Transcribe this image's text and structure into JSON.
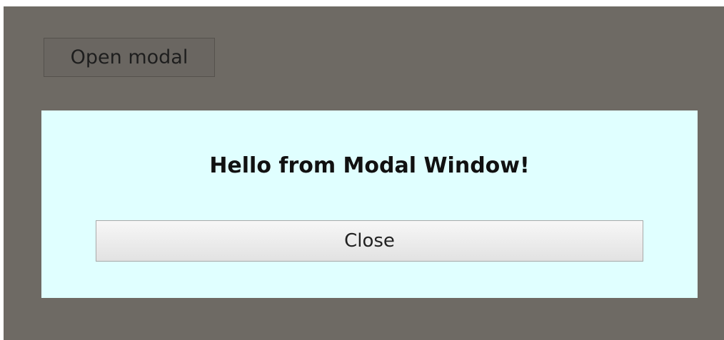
{
  "page": {
    "open_button_label": "Open modal"
  },
  "modal": {
    "title": "Hello from Modal Window!",
    "close_label": "Close"
  },
  "colors": {
    "overlay": "#6e6a64",
    "modal_background": "#e0ffff"
  }
}
